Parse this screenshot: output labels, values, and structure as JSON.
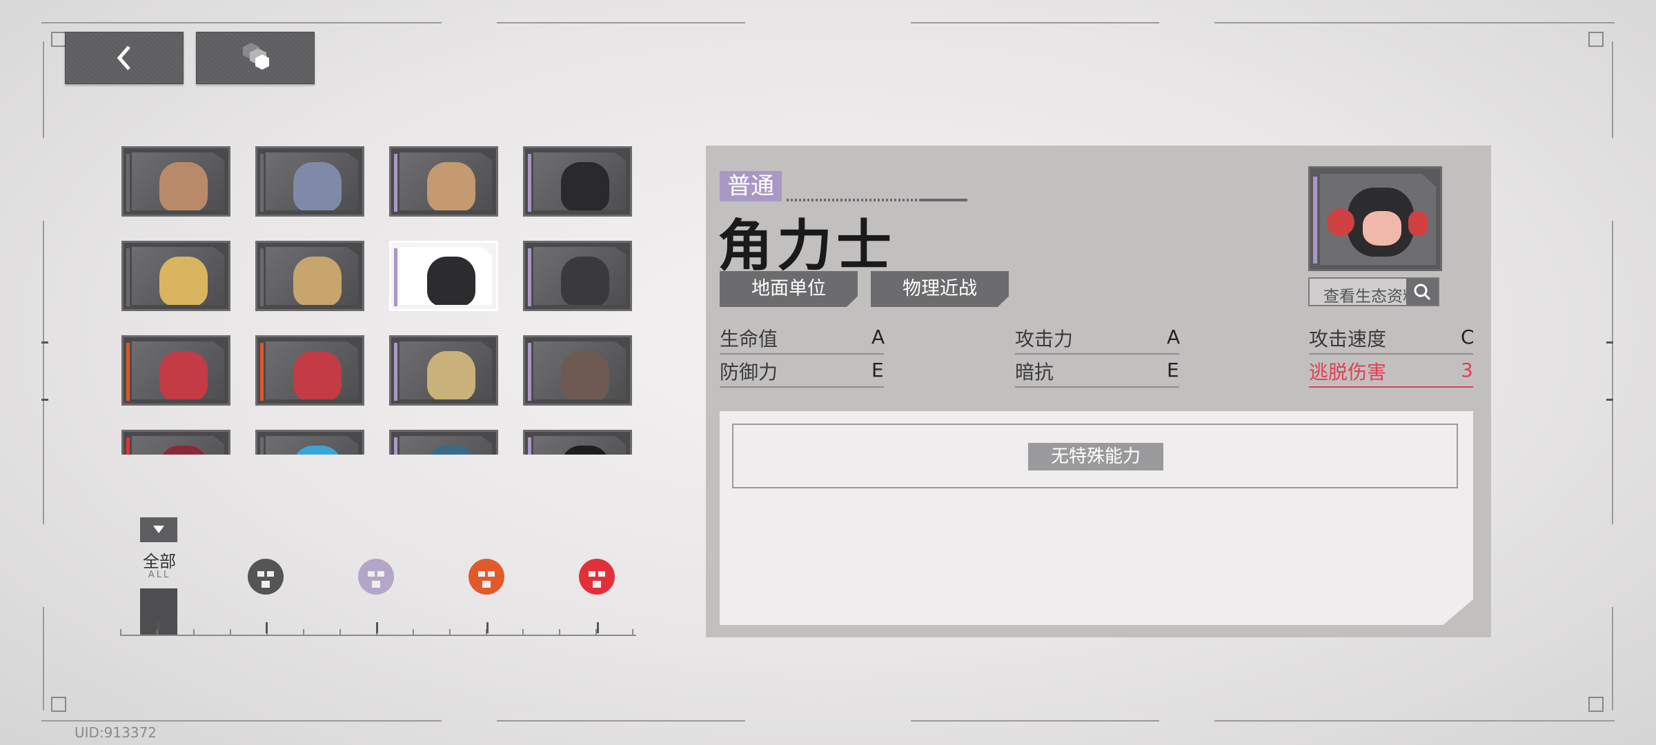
{
  "header": {
    "back_icon": "chevron-left-icon",
    "switch_icon": "cubes-icon"
  },
  "uid": "UID:913372",
  "enemy_grid": {
    "cards": [
      {
        "stripe": "#6a6a6c",
        "fig": "#b98a6a",
        "selected": false
      },
      {
        "stripe": "#6a6a6c",
        "fig": "#7f8aa8",
        "selected": false
      },
      {
        "stripe": "#a998c4",
        "fig": "#c59a70",
        "selected": false
      },
      {
        "stripe": "#a998c4",
        "fig": "#2a2a2c",
        "selected": false
      },
      {
        "stripe": "#6a6a6c",
        "fig": "#d9b560",
        "selected": false
      },
      {
        "stripe": "#6a6a6c",
        "fig": "#c9a56e",
        "selected": false
      },
      {
        "stripe": "#a998c4",
        "fig": "#2c2c2e",
        "selected": true
      },
      {
        "stripe": "#a998c4",
        "fig": "#3a3a3c",
        "selected": false
      },
      {
        "stripe": "#e0552a",
        "fig": "#c33b45",
        "selected": false
      },
      {
        "stripe": "#e0552a",
        "fig": "#c33b45",
        "selected": false
      },
      {
        "stripe": "#a998c4",
        "fig": "#c9b27a",
        "selected": false
      },
      {
        "stripe": "#a998c4",
        "fig": "#6e5a52",
        "selected": false
      },
      {
        "stripe": "#e03040",
        "fig": "#8a2a34",
        "selected": false
      },
      {
        "stripe": "#6a6a6c",
        "fig": "#3aa6d8",
        "selected": false
      },
      {
        "stripe": "#a998c4",
        "fig": "#3a6a8a",
        "selected": false
      },
      {
        "stripe": "#a998c4",
        "fig": "#1e1e20",
        "selected": false
      }
    ]
  },
  "filter": {
    "all_label": "全部",
    "all_sub": "ALL",
    "dropdown_icon": "triangle-down-icon",
    "factions": [
      {
        "icon": "mech-face-icon",
        "color": "#555555"
      },
      {
        "icon": "beast-face-icon",
        "color": "#b3a6c9"
      },
      {
        "icon": "robot-face-icon",
        "color": "#e25a2a"
      },
      {
        "icon": "demon-face-icon",
        "color": "#e2303a"
      }
    ]
  },
  "detail": {
    "rank": "普通",
    "rank_color": "#a998c4",
    "name": "角力士",
    "tags": [
      "地面单位",
      "物理近战"
    ],
    "view_button": "查看生态资料",
    "search_icon": "search-icon",
    "stats": [
      {
        "label": "生命值",
        "value": "A",
        "highlight": false
      },
      {
        "label": "攻击力",
        "value": "A",
        "highlight": false
      },
      {
        "label": "攻击速度",
        "value": "C",
        "highlight": false
      },
      {
        "label": "防御力",
        "value": "E",
        "highlight": false
      },
      {
        "label": "暗抗",
        "value": "E",
        "highlight": false
      },
      {
        "label": "逃脱伤害",
        "value": "3",
        "highlight": true
      }
    ],
    "ability_text": "无特殊能力",
    "highlight_color": "#e04050"
  }
}
